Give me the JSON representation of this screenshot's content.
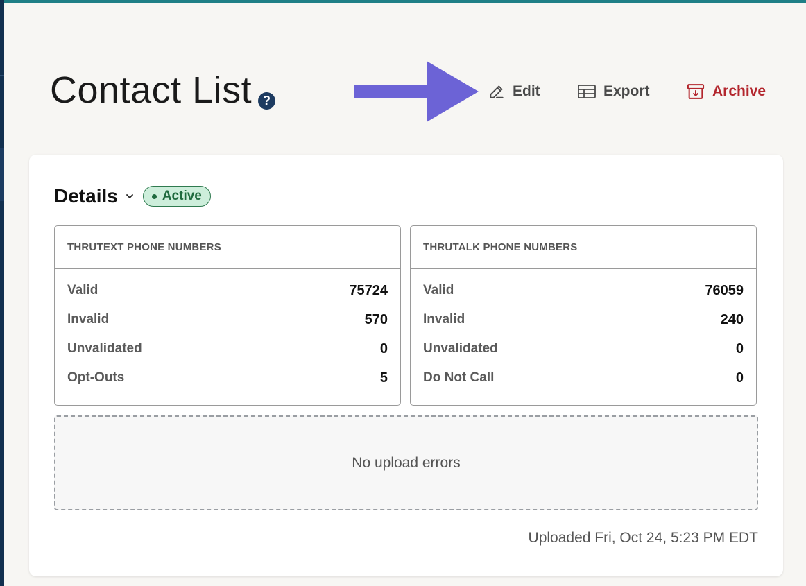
{
  "page": {
    "title": "Contact List",
    "help_icon": "question-circle-icon"
  },
  "toolbar": {
    "edit_label": "Edit",
    "export_label": "Export",
    "archive_label": "Archive",
    "edit_icon": "pencil-icon",
    "export_icon": "table-icon",
    "archive_icon": "archive-box-icon",
    "archive_color": "#b3262d"
  },
  "annotation": {
    "arrow_color": "#6c63d6"
  },
  "details": {
    "title": "Details",
    "status": "Active",
    "status_color": "#1f6a3e"
  },
  "thrutext": {
    "header": "THRUTEXT PHONE NUMBERS",
    "rows": [
      {
        "label": "Valid",
        "value": "75724"
      },
      {
        "label": "Invalid",
        "value": "570"
      },
      {
        "label": "Unvalidated",
        "value": "0"
      },
      {
        "label": "Opt-Outs",
        "value": "5"
      }
    ]
  },
  "thrutalk": {
    "header": "THRUTALK PHONE NUMBERS",
    "rows": [
      {
        "label": "Valid",
        "value": "76059"
      },
      {
        "label": "Invalid",
        "value": "240"
      },
      {
        "label": "Unvalidated",
        "value": "0"
      },
      {
        "label": "Do Not Call",
        "value": "0"
      }
    ]
  },
  "upload": {
    "errors_text": "No upload errors",
    "uploaded_text": "Uploaded Fri, Oct 24, 5:23 PM EDT"
  }
}
